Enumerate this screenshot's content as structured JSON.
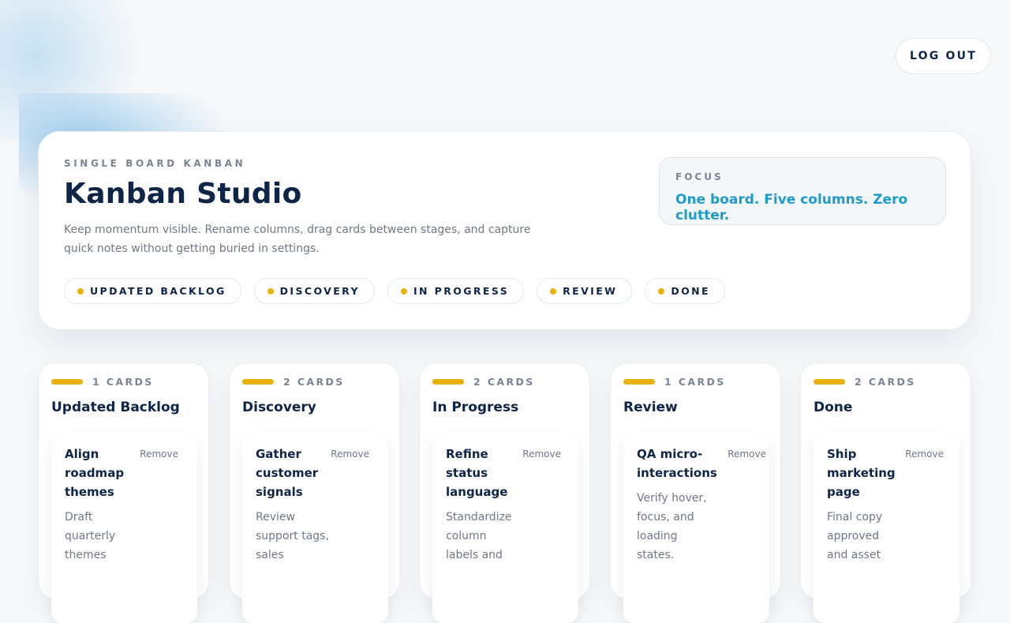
{
  "header": {
    "logout_label": "LOG OUT"
  },
  "hero": {
    "eyebrow": "SINGLE BOARD KANBAN",
    "title": "Kanban Studio",
    "description": "Keep momentum visible. Rename columns, drag cards between stages, and capture quick notes without getting buried in settings.",
    "chips": [
      "UPDATED BACKLOG",
      "DISCOVERY",
      "IN PROGRESS",
      "REVIEW",
      "DONE"
    ],
    "focus_label": "FOCUS",
    "focus_text": "One board. Five columns. Zero clutter."
  },
  "colors": {
    "accent": "#e9b10b",
    "focus": "#1d9ccc",
    "text": "#0f2547",
    "muted": "#6f7886"
  },
  "columns": [
    {
      "count": "1 CARDS",
      "title": "Updated Backlog",
      "card": {
        "title": "Align roadmap themes",
        "remove": "Remove",
        "desc": "Draft quarterly themes"
      }
    },
    {
      "count": "2 CARDS",
      "title": "Discovery",
      "card": {
        "title": "Gather customer signals",
        "remove": "Remove",
        "desc": "Review support tags, sales"
      }
    },
    {
      "count": "2 CARDS",
      "title": "In Progress",
      "card": {
        "title": "Refine status language",
        "remove": "Remove",
        "desc": "Standardize column labels and"
      }
    },
    {
      "count": "1 CARDS",
      "title": "Review",
      "card": {
        "title": "QA micro-interactions",
        "remove": "Remove",
        "desc": "Verify hover, focus, and loading states."
      }
    },
    {
      "count": "2 CARDS",
      "title": "Done",
      "card": {
        "title": "Ship marketing page",
        "remove": "Remove",
        "desc": "Final copy approved and asset"
      }
    }
  ]
}
